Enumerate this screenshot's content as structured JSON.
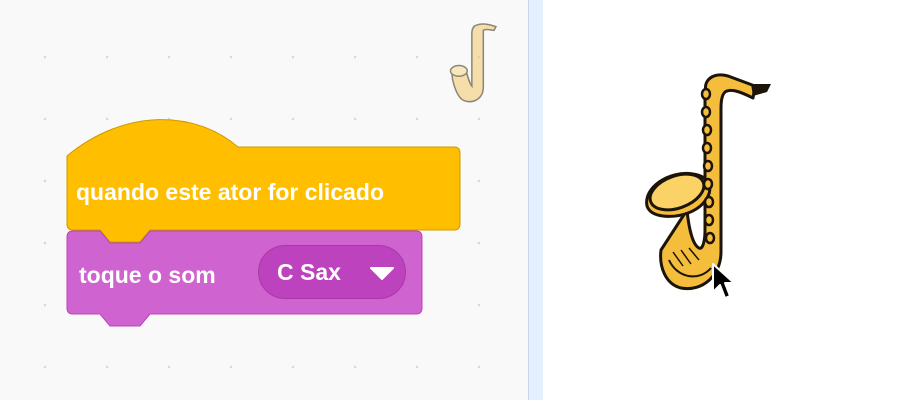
{
  "blocks": {
    "hat": {
      "label": "quando este ator for clicado",
      "color": "#ffbf00",
      "border": "#cc9900"
    },
    "sound": {
      "label": "toque o som",
      "color": "#cf63cf",
      "border": "#bd42bd"
    }
  },
  "dropdown": {
    "value": "C Sax"
  },
  "sprite": {
    "name_icon": "saxophone-icon"
  },
  "colors": {
    "workspace": "#f9f9f9",
    "stage": "#ffffff",
    "scrollbar": "#e5f0ff"
  }
}
